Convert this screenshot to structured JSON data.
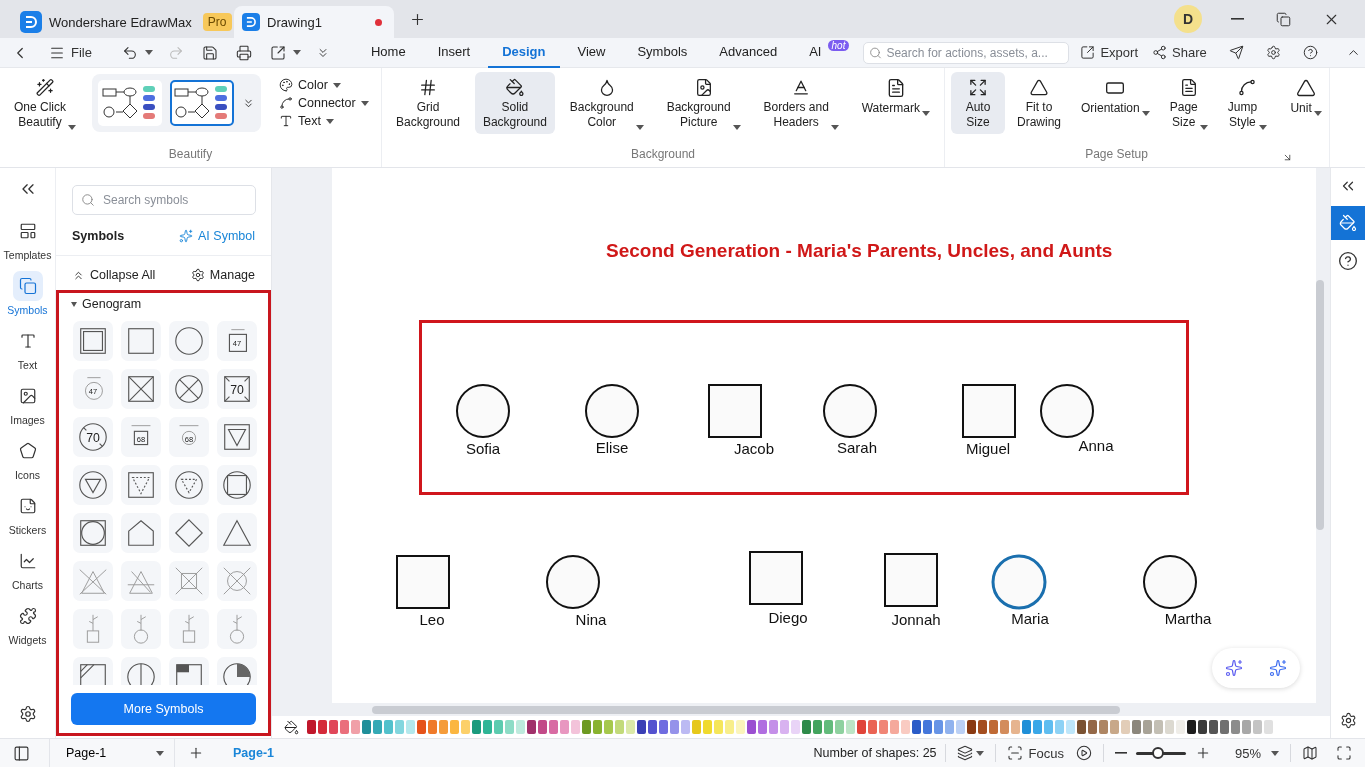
{
  "title_bar": {
    "tabs": [
      {
        "label": "Wondershare EdrawMax",
        "badge": "Pro",
        "selected": false
      },
      {
        "label": "Drawing1",
        "selected": true,
        "unsaved": true
      }
    ],
    "avatar": "D"
  },
  "menu_bar": {
    "file": "File",
    "tabs": [
      {
        "label": "Home",
        "selected": false
      },
      {
        "label": "Insert",
        "selected": false
      },
      {
        "label": "Design",
        "selected": true
      },
      {
        "label": "View",
        "selected": false
      },
      {
        "label": "Symbols",
        "selected": false
      },
      {
        "label": "Advanced",
        "selected": false
      },
      {
        "label": "AI",
        "badge": "hot",
        "selected": false
      }
    ],
    "search": {
      "placeholder": "Search for actions, assets, a..."
    },
    "export": "Export",
    "share": "Share"
  },
  "ribbon": [
    {
      "title": "Beautify",
      "buttons": [
        {
          "label": "One Click\nBeautify",
          "dropdown": true,
          "selected": false
        }
      ],
      "styles": [
        {
          "selected": false
        },
        {
          "selected": true
        }
      ],
      "menus": [
        "Color",
        "Connector",
        "Text"
      ]
    },
    {
      "title": "Background",
      "buttons": [
        {
          "label": "Grid\nBackground",
          "dropdown": false,
          "selected": false
        },
        {
          "label": "Solid\nBackground",
          "dropdown": false,
          "selected": true
        },
        {
          "label": "Background\nColor",
          "dropdown": true,
          "selected": false
        },
        {
          "label": "Background\nPicture",
          "dropdown": true,
          "selected": false
        },
        {
          "label": "Borders and\nHeaders",
          "dropdown": true,
          "selected": false
        },
        {
          "label": "Watermark",
          "dropdown": true,
          "selected": false
        }
      ]
    },
    {
      "title": "Page Setup",
      "buttons": [
        {
          "label": "Auto\nSize",
          "dropdown": false,
          "selected": true
        },
        {
          "label": "Fit to\nDrawing",
          "dropdown": false,
          "selected": false
        },
        {
          "label": "Orientation",
          "dropdown": true,
          "selected": false
        },
        {
          "label": "Page\nSize",
          "dropdown": true,
          "selected": false
        },
        {
          "label": "Jump\nStyle",
          "dropdown": true,
          "selected": false
        },
        {
          "label": "Unit",
          "dropdown": true,
          "selected": false
        }
      ]
    }
  ],
  "left_rail": [
    {
      "label": "Templates",
      "selected": false
    },
    {
      "label": "Symbols",
      "selected": true
    },
    {
      "label": "Text",
      "selected": false
    },
    {
      "label": "Images",
      "selected": false
    },
    {
      "label": "Icons",
      "selected": false
    },
    {
      "label": "Stickers",
      "selected": false
    },
    {
      "label": "Charts",
      "selected": false
    },
    {
      "label": "Widgets",
      "selected": false
    }
  ],
  "symbols_panel": {
    "search": {
      "placeholder": "Search symbols"
    },
    "title": "Symbols",
    "ai_symbol": "AI Symbol",
    "collapse_all": "Collapse All",
    "manage": "Manage",
    "category": {
      "label": "Genogram",
      "expanded": true
    },
    "symbols": [
      {
        "kind": "double-square"
      },
      {
        "kind": "square"
      },
      {
        "kind": "circle"
      },
      {
        "kind": "aged-square",
        "label": "47"
      },
      {
        "kind": "aged-circle",
        "label": "47"
      },
      {
        "kind": "crossed-square"
      },
      {
        "kind": "crossed-circle"
      },
      {
        "kind": "crossed-square",
        "label": "70"
      },
      {
        "kind": "crossed-circle",
        "label": "70"
      },
      {
        "kind": "small-square",
        "label": "68"
      },
      {
        "kind": "small-circle",
        "label": "68"
      },
      {
        "kind": "triangle-square"
      },
      {
        "kind": "triangle-circle"
      },
      {
        "kind": "dotted-square"
      },
      {
        "kind": "dotted-circle"
      },
      {
        "kind": "circle-square"
      },
      {
        "kind": "square-circle"
      },
      {
        "kind": "pentagon"
      },
      {
        "kind": "diamond"
      },
      {
        "kind": "triangle"
      },
      {
        "kind": "x-triangle"
      },
      {
        "kind": "struck-triangle"
      },
      {
        "kind": "x-box"
      },
      {
        "kind": "x-ring"
      },
      {
        "kind": "sprout-square"
      },
      {
        "kind": "sprout-circle"
      },
      {
        "kind": "sprout-square"
      },
      {
        "kind": "sprout-circle"
      },
      {
        "kind": "hatched-square"
      },
      {
        "kind": "split-circle"
      },
      {
        "kind": "shaded-square"
      },
      {
        "kind": "quarter-circle"
      }
    ],
    "more": "More Symbols"
  },
  "canvas": {
    "title": "Second Generation - Maria's Parents, Uncles, and Aunts",
    "people": [
      {
        "kind": "circle",
        "name": "Sofia",
        "selected": false
      },
      {
        "kind": "circle",
        "name": "Elise",
        "selected": false
      },
      {
        "kind": "square",
        "name": "Jacob",
        "selected": false
      },
      {
        "kind": "circle",
        "name": "Sarah",
        "selected": false
      },
      {
        "kind": "square",
        "name": "Miguel",
        "selected": false
      },
      {
        "kind": "circle",
        "name": "Anna",
        "selected": false
      },
      {
        "kind": "square",
        "name": "Leo",
        "selected": false
      },
      {
        "kind": "circle",
        "name": "Nina",
        "selected": false
      },
      {
        "kind": "square",
        "name": "Diego",
        "selected": false
      },
      {
        "kind": "square",
        "name": "Jonnah",
        "selected": false
      },
      {
        "kind": "circle",
        "name": "Maria",
        "selected": true
      },
      {
        "kind": "circle",
        "name": "Martha",
        "selected": false
      }
    ]
  },
  "palette": [
    {
      "color": "#c0172b"
    },
    {
      "color": "#d42a3a"
    },
    {
      "color": "#e0475a"
    },
    {
      "color": "#ea6f7c"
    },
    {
      "color": "#f0a0a8"
    },
    {
      "color": "#1f8f9a"
    },
    {
      "color": "#34a9b5"
    },
    {
      "color": "#52c1cc"
    },
    {
      "color": "#82d6de"
    },
    {
      "color": "#b3e8ec"
    },
    {
      "color": "#e5531a"
    },
    {
      "color": "#ef7a2a"
    },
    {
      "color": "#f59c3a"
    },
    {
      "color": "#fbb640"
    },
    {
      "color": "#fcd06a"
    },
    {
      "color": "#1a9b7e"
    },
    {
      "color": "#2fb596"
    },
    {
      "color": "#5ccbaf"
    },
    {
      "color": "#8ddcc6"
    },
    {
      "color": "#bdeadd"
    },
    {
      "color": "#a0306a"
    },
    {
      "color": "#c24a88"
    },
    {
      "color": "#d86ba3"
    },
    {
      "color": "#e897c0"
    },
    {
      "color": "#f3c3da"
    },
    {
      "color": "#6d9a22"
    },
    {
      "color": "#89b32f"
    },
    {
      "color": "#a6c84c"
    },
    {
      "color": "#c2da7a"
    },
    {
      "color": "#dbe9a8"
    },
    {
      "color": "#3a3fb5"
    },
    {
      "color": "#5452cf"
    },
    {
      "color": "#6f6ce0"
    },
    {
      "color": "#9592ea"
    },
    {
      "color": "#bcbaf3"
    },
    {
      "color": "#e6c81a"
    },
    {
      "color": "#f0da2e"
    },
    {
      "color": "#f5e65a"
    },
    {
      "color": "#f8ee8a"
    },
    {
      "color": "#fbf5bb"
    },
    {
      "color": "#9b4fd1"
    },
    {
      "color": "#b06ee0"
    },
    {
      "color": "#c48fe8"
    },
    {
      "color": "#d8b2f0"
    },
    {
      "color": "#e9d4f7"
    },
    {
      "color": "#2e8b4a"
    },
    {
      "color": "#43a45e"
    },
    {
      "color": "#62bb7b"
    },
    {
      "color": "#8ed19f"
    },
    {
      "color": "#bce5c6"
    },
    {
      "color": "#e0443a"
    },
    {
      "color": "#ea6354"
    },
    {
      "color": "#f08576"
    },
    {
      "color": "#f5a99c"
    },
    {
      "color": "#f9cbc2"
    },
    {
      "color": "#2a5cc8"
    },
    {
      "color": "#4577db"
    },
    {
      "color": "#6794e6"
    },
    {
      "color": "#90b2ee"
    },
    {
      "color": "#bbd0f5"
    },
    {
      "color": "#8a3a12"
    },
    {
      "color": "#a44e20"
    },
    {
      "color": "#bf6a35"
    },
    {
      "color": "#d38c5c"
    },
    {
      "color": "#e6b48f"
    },
    {
      "color": "#1f8fd8"
    },
    {
      "color": "#3aa7e8"
    },
    {
      "color": "#5fbdf0"
    },
    {
      "color": "#8dd2f5"
    },
    {
      "color": "#bde6fa"
    },
    {
      "color": "#7a5232"
    },
    {
      "color": "#946848"
    },
    {
      "color": "#ae8664"
    },
    {
      "color": "#c8a889"
    },
    {
      "color": "#e2cdb8"
    },
    {
      "color": "#8c877c"
    },
    {
      "color": "#a8a397"
    },
    {
      "color": "#c3bfb4"
    },
    {
      "color": "#dcd9d0"
    },
    {
      "color": "#efede8"
    },
    {
      "color": "#1c1c1c"
    },
    {
      "color": "#3b3b3b"
    },
    {
      "color": "#555555"
    },
    {
      "color": "#707070"
    },
    {
      "color": "#8c8c8c"
    },
    {
      "color": "#a8a8a8"
    },
    {
      "color": "#c4c4c4"
    },
    {
      "color": "#e0e0e0"
    }
  ],
  "status_bar": {
    "page_select": "Page-1",
    "pages": [
      {
        "label": "Page-1",
        "selected": true
      }
    ],
    "shape_count": "Number of shapes: 25",
    "focus": "Focus",
    "zoom": {
      "level": 0.45,
      "reading": "95%"
    }
  }
}
